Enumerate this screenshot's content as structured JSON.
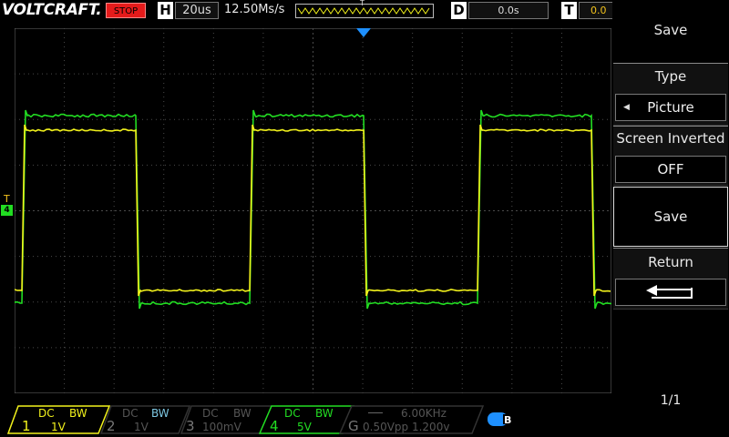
{
  "header": {
    "brand": "VOLTCRAFT.",
    "run_state": "STOP",
    "horizontal_key": "H",
    "timebase": "20us",
    "sample_rate": "12.50Ms/s",
    "trigger_marker": "T",
    "delay_key": "D",
    "delay_value": "0.0s",
    "trigger_key": "T",
    "trigger_value": "0.0"
  },
  "menu": {
    "title": "Save",
    "type_label": "Type",
    "type_value": "Picture",
    "inverted_label": "Screen Inverted",
    "inverted_value": "OFF",
    "save_button": "Save",
    "return_label": "Return",
    "page": "1/1"
  },
  "markers": {
    "trigger_level": "T",
    "ground_channel": "4"
  },
  "channels": [
    {
      "num": "1",
      "coupling": "DC",
      "bw": "BW",
      "scale": "1V",
      "active": true,
      "color": "#f2f21c"
    },
    {
      "num": "2",
      "coupling": "DC",
      "bw": "BW",
      "scale": "1V",
      "active": false,
      "color": "#7ec8e3"
    },
    {
      "num": "3",
      "coupling": "DC",
      "bw": "BW",
      "scale": "100mV",
      "active": false,
      "color": "#888888"
    },
    {
      "num": "4",
      "coupling": "DC",
      "bw": "BW",
      "scale": "5V",
      "active": true,
      "color": "#22dd22"
    }
  ],
  "trigger_info": {
    "key": "G",
    "frequency": "6.00KHz",
    "level": "0.50Vpp 1.200v"
  },
  "colors": {
    "ch1": "#f2f21c",
    "ch4": "#22dd22",
    "stop": "#e51b1b",
    "trigger_marker": "#1e90ff"
  },
  "icons": {
    "usb": "usb-icon",
    "return": "return-arrow-icon",
    "left": "triangle-left-icon"
  }
}
